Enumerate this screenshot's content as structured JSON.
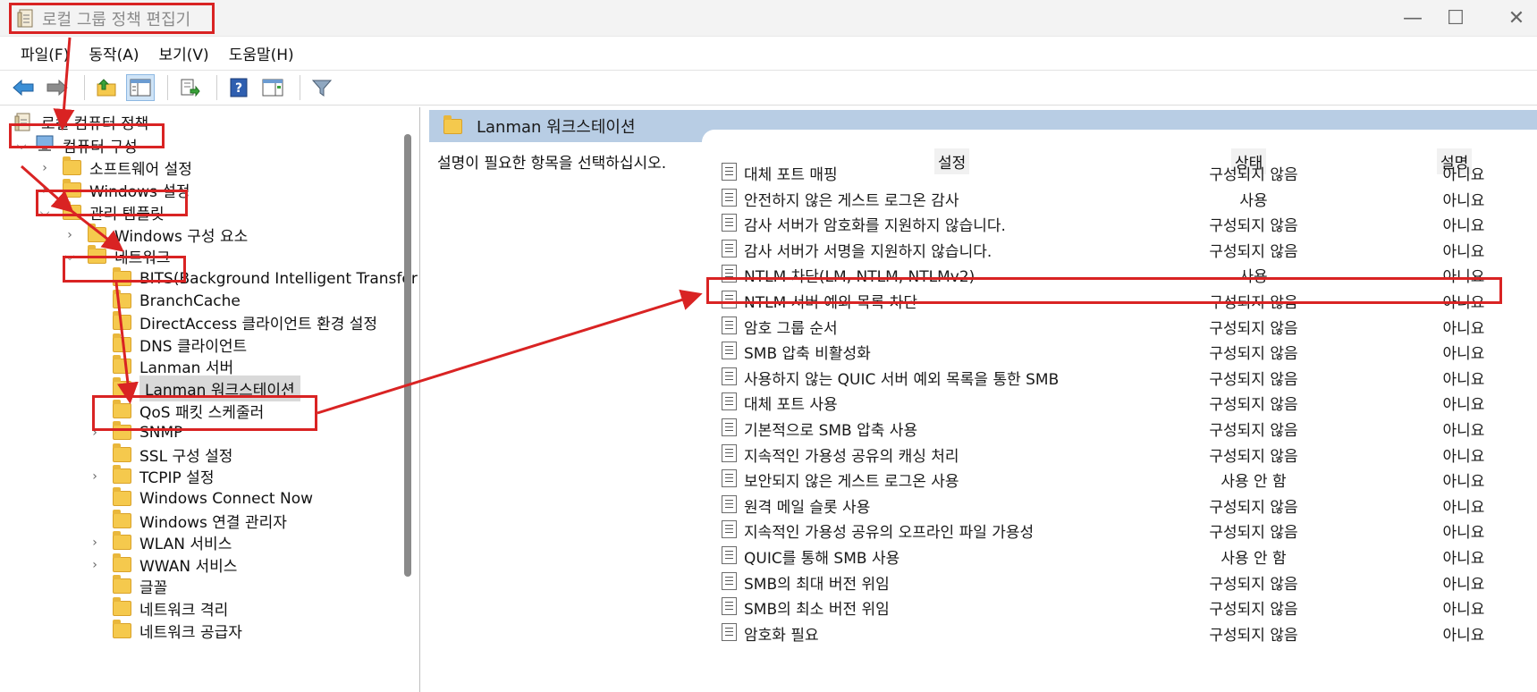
{
  "window": {
    "title": "로컬 그룹 정책 편집기",
    "minimize_glyph": "—",
    "maximize_glyph": "☐",
    "close_glyph": "✕"
  },
  "menu": [
    "파일(F)",
    "동작(A)",
    "보기(V)",
    "도움말(H)"
  ],
  "toolbar_icons": [
    "back-arrow-icon",
    "forward-arrow-icon",
    "up-folder-icon",
    "show-tree-icon",
    "export-list-icon",
    "help-icon",
    "properties-pane-icon",
    "filter-icon"
  ],
  "tree": {
    "root": "로컬 컴퓨터 정책",
    "computer_config": "컴퓨터 구성",
    "software_settings": "소프트웨어 설정",
    "windows_settings": "Windows 설정",
    "admin_templates": "관리 템플릿",
    "windows_components": "Windows 구성 요소",
    "network": "네트워크",
    "network_children": [
      "BITS(Background Intelligent Transfer",
      "BranchCache",
      "DirectAccess 클라이언트 환경 설정",
      "DNS 클라이언트",
      "Lanman 서버",
      "Lanman 워크스테이션",
      "QoS 패킷 스케줄러",
      "SNMP",
      "SSL 구성 설정",
      "TCPIP 설정",
      "Windows Connect Now",
      "Windows 연결 관리자",
      "WLAN 서비스",
      "WWAN 서비스",
      "글꼴",
      "네트워크 격리",
      "네트워크 공급자"
    ]
  },
  "details": {
    "header": "Lanman 워크스테이션",
    "description": "설명이 필요한 항목을 선택하십시오.",
    "columns": {
      "setting": "설정",
      "state": "상태",
      "comment": "설명"
    },
    "rows": [
      {
        "name": "대체 포트 매핑",
        "state": "구성되지 않음",
        "comment": "아니요"
      },
      {
        "name": "안전하지 않은 게스트 로그온 감사",
        "state": "사용",
        "comment": "아니요"
      },
      {
        "name": "감사 서버가 암호화를 지원하지 않습니다.",
        "state": "구성되지 않음",
        "comment": "아니요"
      },
      {
        "name": "감사 서버가 서명을 지원하지 않습니다.",
        "state": "구성되지 않음",
        "comment": "아니요"
      },
      {
        "name": "NTLM 차단(LM, NTLM, NTLMv2)",
        "state": "사용",
        "comment": "아니요"
      },
      {
        "name": "NTLM 서버 예외 목록 차단",
        "state": "구성되지 않음",
        "comment": "아니요"
      },
      {
        "name": "암호 그룹 순서",
        "state": "구성되지 않음",
        "comment": "아니요"
      },
      {
        "name": "SMB 압축 비활성화",
        "state": "구성되지 않음",
        "comment": "아니요"
      },
      {
        "name": "사용하지 않는 QUIC 서버 예외 목록을 통한 SMB",
        "state": "구성되지 않음",
        "comment": "아니요"
      },
      {
        "name": "대체 포트 사용",
        "state": "구성되지 않음",
        "comment": "아니요"
      },
      {
        "name": "기본적으로 SMB 압축 사용",
        "state": "구성되지 않음",
        "comment": "아니요"
      },
      {
        "name": "지속적인 가용성 공유의 캐싱 처리",
        "state": "구성되지 않음",
        "comment": "아니요"
      },
      {
        "name": "보안되지 않은 게스트 로그온 사용",
        "state": "사용 안 함",
        "comment": "아니요"
      },
      {
        "name": "원격 메일 슬롯 사용",
        "state": "구성되지 않음",
        "comment": "아니요"
      },
      {
        "name": "지속적인 가용성 공유의 오프라인 파일 가용성",
        "state": "구성되지 않음",
        "comment": "아니요"
      },
      {
        "name": "QUIC를 통해 SMB 사용",
        "state": "사용 안 함",
        "comment": "아니요"
      },
      {
        "name": "SMB의 최대 버전 위임",
        "state": "구성되지 않음",
        "comment": "아니요"
      },
      {
        "name": "SMB의 최소 버전 위임",
        "state": "구성되지 않음",
        "comment": "아니요"
      },
      {
        "name": "암호화 필요",
        "state": "구성되지 않음",
        "comment": "아니요"
      }
    ]
  },
  "colors": {
    "annotation": "#d92323",
    "header_band": "#b8cde4",
    "folder": "#f5c94d"
  }
}
